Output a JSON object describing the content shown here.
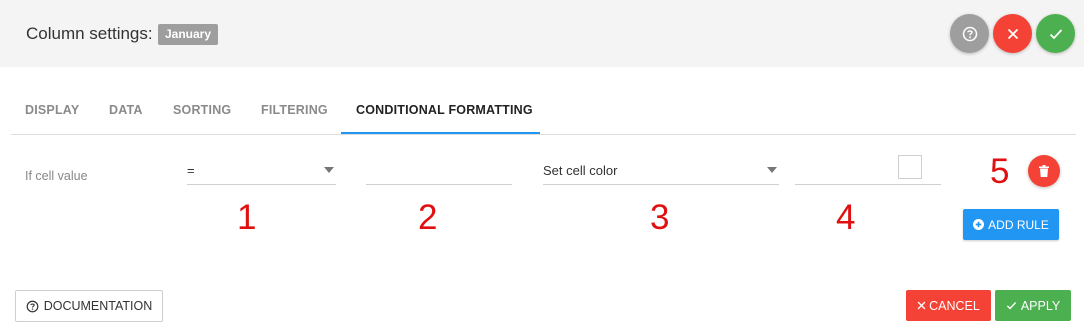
{
  "header": {
    "title": "Column settings:",
    "column_badge": "January"
  },
  "tabs": [
    {
      "label": "DISPLAY",
      "active": false
    },
    {
      "label": "DATA",
      "active": false
    },
    {
      "label": "SORTING",
      "active": false
    },
    {
      "label": "FILTERING",
      "active": false
    },
    {
      "label": "CONDITIONAL FORMATTING",
      "active": true
    }
  ],
  "rule": {
    "label": "If cell value",
    "operator": "=",
    "value": "",
    "action": "Set cell color",
    "color": ""
  },
  "annotations": [
    "1",
    "2",
    "3",
    "4",
    "5"
  ],
  "buttons": {
    "add_rule": "ADD RULE",
    "documentation": "DOCUMENTATION",
    "cancel": "CANCEL",
    "apply": "APPLY"
  },
  "icons": {
    "help": "help-circle-icon",
    "close": "close-icon",
    "confirm": "check-icon",
    "delete": "trash-icon",
    "add": "plus-circle-icon"
  },
  "colors": {
    "primary": "#2196f3",
    "danger": "#f44336",
    "success": "#4caf50",
    "neutral": "#9e9e9e",
    "annotation": "#e01010"
  }
}
